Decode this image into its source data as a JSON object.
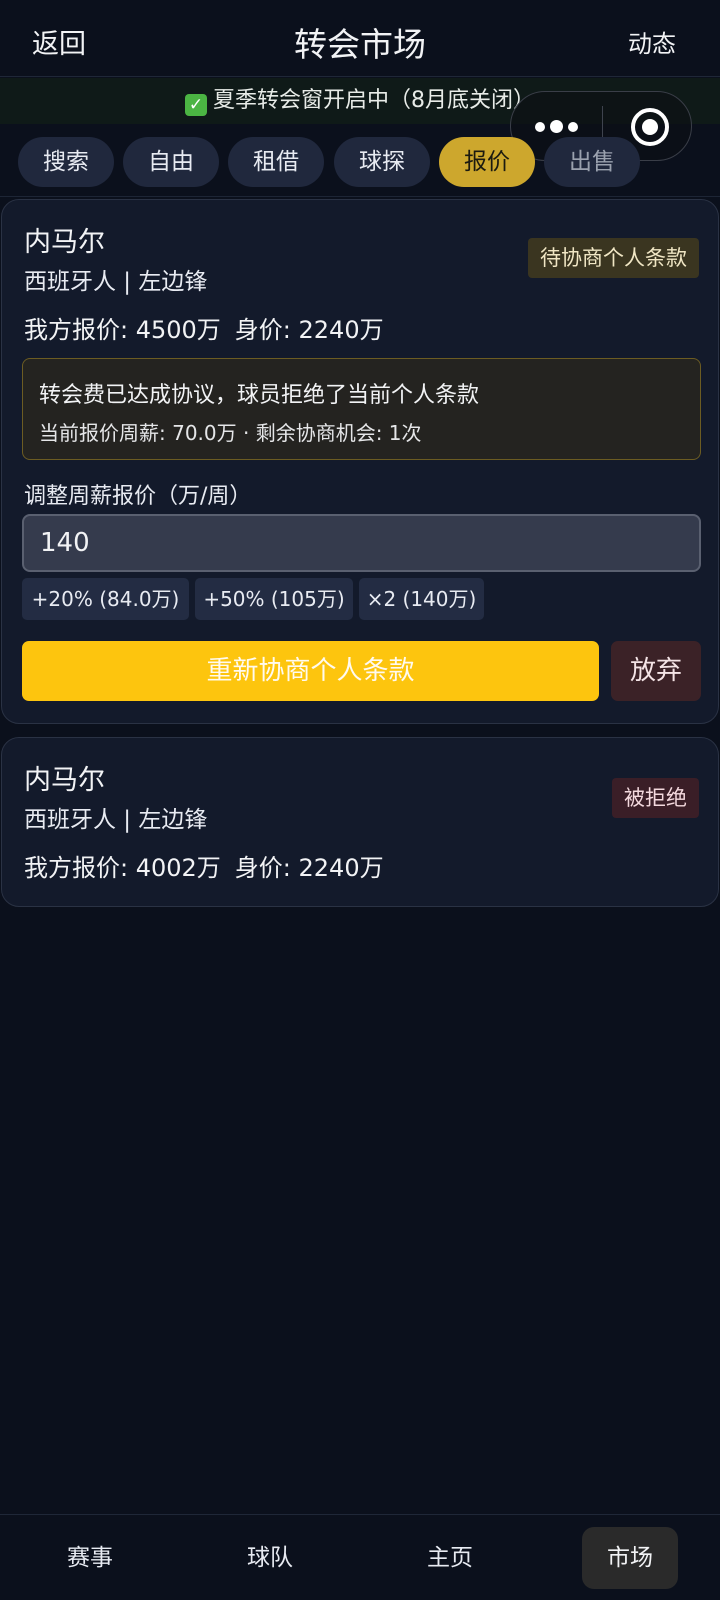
{
  "header": {
    "back_label": "返回",
    "title": "转会市场",
    "feed_label": "动态"
  },
  "notice": {
    "icon": "check-icon",
    "icon_color": "#4bb543",
    "text": "夏季转会窗开启中（8月底关闭）"
  },
  "capsule": {
    "more_icon": "more-dots-icon",
    "close_icon": "target-icon"
  },
  "tabs": [
    {
      "label": "搜索"
    },
    {
      "label": "自由"
    },
    {
      "label": "租借"
    },
    {
      "label": "球探"
    },
    {
      "label": "报价",
      "active": true
    },
    {
      "label": "出售"
    }
  ],
  "offers": [
    {
      "name": "内马尔",
      "meta": "西班牙人 | 左边锋",
      "status": "待协商个人条款",
      "our_offer": "我方报价: 4500万",
      "value": "身价: 2240万",
      "info_title": "转会费已达成协议，球员拒绝了当前个人条款",
      "info_detail": "当前报价周薪: 70.0万 · 剩余协商机会: 1次",
      "adjust_label": "调整周薪报价（万/周）",
      "wage_value": "140",
      "chips": [
        "+20% (84.0万)",
        "+50% (105万)",
        "×2 (140万)"
      ],
      "renegotiate_label": "重新协商个人条款",
      "give_up_label": "放弃"
    },
    {
      "name": "内马尔",
      "meta": "西班牙人 | 左边锋",
      "status": "被拒绝",
      "our_offer": "我方报价: 4002万",
      "value": "身价: 2240万"
    }
  ],
  "bottom_nav": [
    {
      "label": "赛事"
    },
    {
      "label": "球队"
    },
    {
      "label": "主页"
    },
    {
      "label": "市场",
      "active": true
    }
  ],
  "colors": {
    "background": "#0b101c",
    "accent_yellow": "#fdc50e",
    "active_tab": "#cda72d",
    "card": "#131a2b"
  }
}
